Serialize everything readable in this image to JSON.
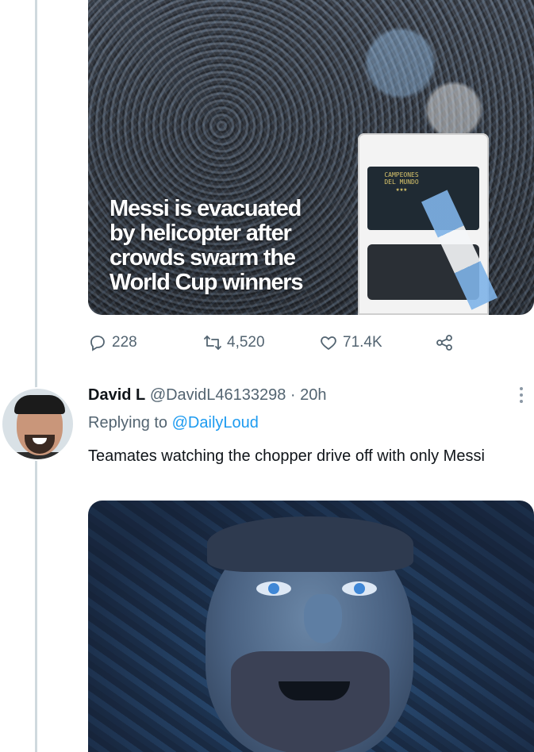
{
  "first_tweet": {
    "media": {
      "headline_lines": [
        "Messi is evacuated",
        "by helicopter after",
        "crowds swarm the",
        "World Cup winners"
      ],
      "bus_sign_lines": [
        "CAMPEONES",
        "DEL MUNDO",
        "★★★"
      ]
    },
    "actions": {
      "replies": "228",
      "retweets": "4,520",
      "likes": "71.4K"
    }
  },
  "reply_tweet": {
    "display_name": "David L",
    "handle": "@DavidL46133298",
    "separator": "·",
    "time": "20h",
    "replying_prefix": "Replying to",
    "replying_to": "@DailyLoud",
    "text": "Teamates watching the chopper drive off with only Messi"
  },
  "colors": {
    "text_primary": "#0f1419",
    "text_secondary": "#536471",
    "link": "#1d9bf0",
    "thread_line": "#cfd9de"
  },
  "icons": [
    "reply-icon",
    "retweet-icon",
    "like-icon",
    "share-icon",
    "more-icon"
  ]
}
